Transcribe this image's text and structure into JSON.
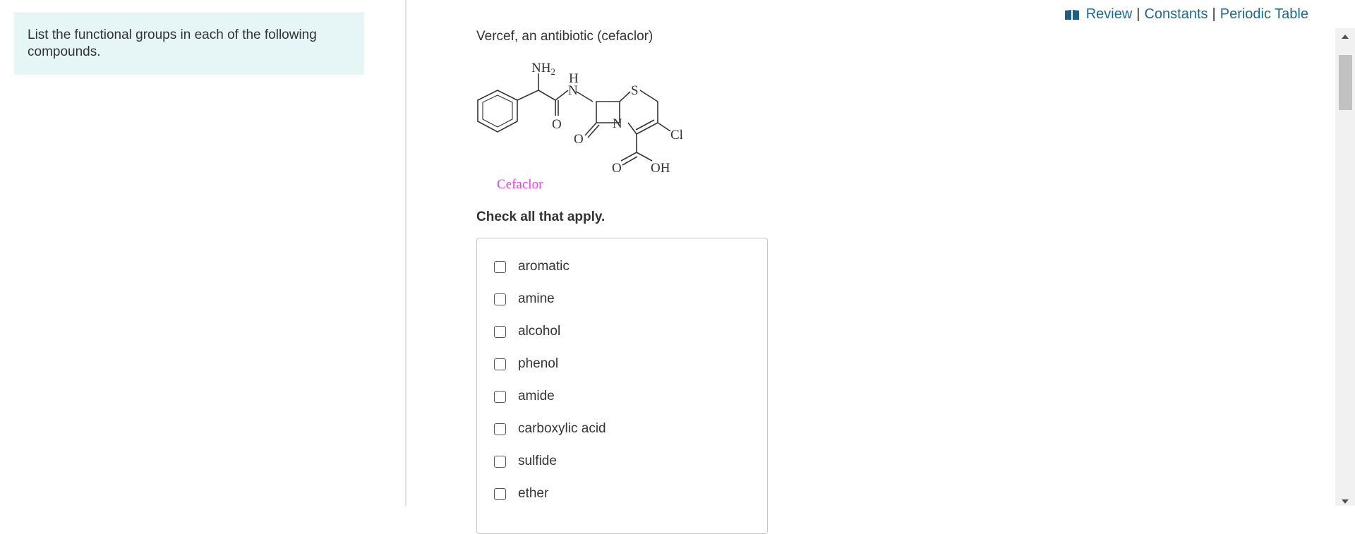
{
  "instructions": {
    "text": "List the functional groups in each of the following compounds."
  },
  "links": {
    "review": "Review",
    "separator": "|",
    "constants": "Constants",
    "periodic_table": "Periodic Table"
  },
  "question": {
    "title": "Vercef, an antibiotic (cefaclor)",
    "molecule": {
      "name_label": "Cefaclor",
      "name_color": "#ff33ff",
      "nh2": "NH",
      "nh2_sub": "2",
      "h": "H",
      "n": "N",
      "s": "S",
      "o": "O",
      "cl": "Cl",
      "oh": "OH"
    },
    "check_note": "Check all that apply."
  },
  "choices": [
    "aromatic",
    "amine",
    "alcohol",
    "phenol",
    "amide",
    "carboxylic acid",
    "sulfide",
    "ether"
  ],
  "colors": {
    "link": "#1a6a96",
    "instructions_bg": "#e6f5f5",
    "text": "#333333"
  }
}
